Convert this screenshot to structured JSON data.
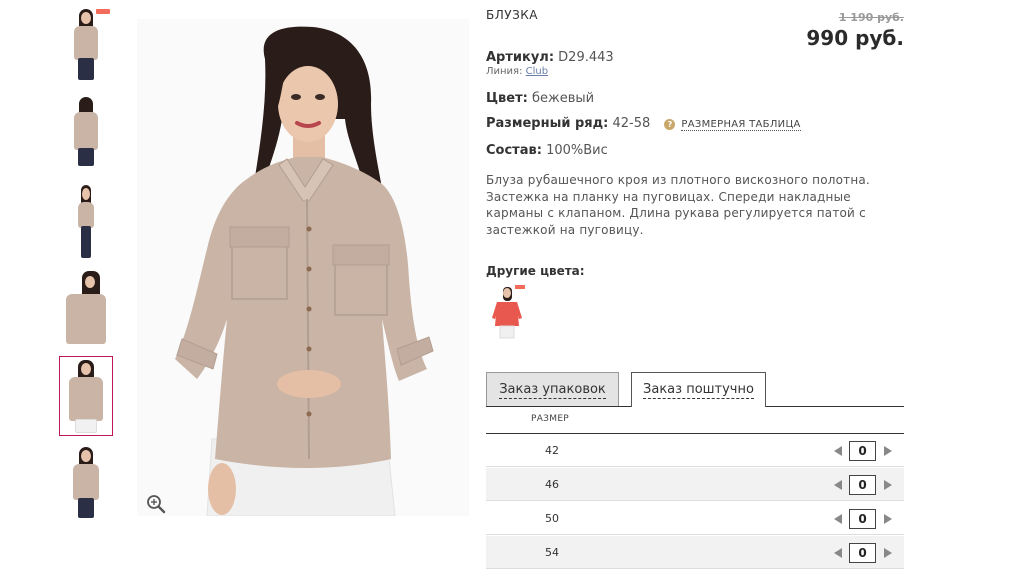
{
  "thumbnails": [
    {
      "name": "thumb-front",
      "sale": true,
      "selected": false
    },
    {
      "name": "thumb-back",
      "sale": false,
      "selected": false
    },
    {
      "name": "thumb-side",
      "sale": false,
      "selected": false
    },
    {
      "name": "thumb-detail",
      "sale": false,
      "selected": false
    },
    {
      "name": "thumb-front-open",
      "sale": false,
      "selected": true
    },
    {
      "name": "thumb-front-2",
      "sale": false,
      "selected": false
    }
  ],
  "product": {
    "title": "БЛУЗКА",
    "old_price": "1 190 руб.",
    "price": "990 руб.",
    "article_label": "Артикул:",
    "article_value": "D29.443",
    "line_label": "Линия:",
    "line_value": "Club",
    "color_label": "Цвет:",
    "color_value": "бежевый",
    "size_range_label": "Размерный ряд:",
    "size_range_value": "42-58",
    "size_chart_icon": "?",
    "size_chart_link": "РАЗМЕРНАЯ ТАБЛИЦА",
    "composition_label": "Состав:",
    "composition_value": "100%Вис",
    "description": "Блуза  рубашечного кроя из плотного вискозного полотна. Застежка на планку на пуговицах. Спереди накладные карманы с клапаном. Длина рукава регулируется патой с застежкой на пуговицу."
  },
  "other_colors": {
    "title": "Другие цвета:",
    "items": [
      {
        "name": "coral-variant",
        "color": "#e8584f",
        "sale": true
      }
    ]
  },
  "tabs": [
    {
      "label": "Заказ упаковок",
      "active": false
    },
    {
      "label": "Заказ поштучно",
      "active": true
    }
  ],
  "order_table": {
    "header_size": "РАЗМЕР",
    "rows": [
      {
        "size": "42",
        "qty": "0"
      },
      {
        "size": "46",
        "qty": "0"
      },
      {
        "size": "50",
        "qty": "0"
      },
      {
        "size": "54",
        "qty": "0"
      }
    ]
  },
  "colors": {
    "blouse": "#c9b4a6",
    "accent": "#c2185b",
    "sale": "#f26b5b"
  }
}
